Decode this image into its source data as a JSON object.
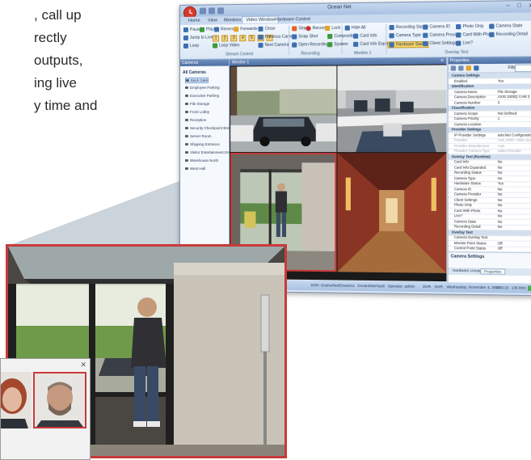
{
  "side_text": {
    "lines": [
      ", call up",
      "rectly",
      "outputs,",
      "ing live",
      "y time and"
    ]
  },
  "app": {
    "title": "Ocean Net",
    "window_buttons": [
      "–",
      "□",
      "✕"
    ],
    "ribbon_tabs": [
      "Home",
      "View",
      "Monitors",
      "Video Window",
      "Hardware Control"
    ],
    "active_tab": "Video Window",
    "ribbon": {
      "stream_control": {
        "label": "Stream Control",
        "buttons": [
          "Pause",
          "Play",
          "Reverse",
          "Forwards",
          "Close",
          "Jump to Live",
          "Loop",
          "Loop Video",
          "Previous Camera",
          "Next Camera"
        ],
        "numbers": [
          "1",
          "2",
          "3",
          "4",
          "5",
          "6",
          "7"
        ]
      },
      "recording": {
        "label": "Recording",
        "buttons": [
          "Snap Shot",
          "Open Recording",
          "Stop",
          "Record",
          "Lock"
        ]
      },
      "monitor1": {
        "label": "Monitor 1",
        "buttons": [
          "Composite",
          "System",
          "Hide All",
          "Card Info",
          "Card Info Expanded"
        ]
      },
      "overlay_text": {
        "label": "Overlay Text",
        "buttons": [
          "Recording Status",
          "Camera Type",
          "Hardware Status",
          "Camera ID",
          "Camera Provider",
          "Client Settings",
          "Photo Only",
          "Card With Photo",
          "Live?",
          "Camera State",
          "Recording Detail"
        ]
      }
    },
    "cameras_panel": {
      "title": "Cameras",
      "all_label": "All Cameras",
      "items": [
        "Back Gate",
        "Employee Parking",
        "Executive Parking",
        "File Storage",
        "Front Lobby",
        "Reception",
        "Security Checkpoint Breva",
        "Server Room",
        "Shipping Entrance",
        "Visitor Entertainment Entran..",
        "Warehouse North",
        "West Hall"
      ]
    },
    "monitor": {
      "title": "Monitor 1",
      "close": "✕"
    },
    "properties": {
      "title": "Properties",
      "filter_label": "Filter:",
      "rows": [
        {
          "key": "Camera Settings",
          "value": "",
          "section": true
        },
        {
          "key": "Enabled",
          "value": "Yes"
        },
        {
          "key": "Identification",
          "value": "",
          "section": true
        },
        {
          "key": "Camera Name",
          "value": "File Storage"
        },
        {
          "key": "Camera Description",
          "value": "AXIS 2400Q CAM 3"
        },
        {
          "key": "Camera Number",
          "value": "3"
        },
        {
          "key": "Classification",
          "value": "",
          "section": true
        },
        {
          "key": "Camera Scope",
          "value": "Not Defined"
        },
        {
          "key": "Camera Priority",
          "value": "1"
        },
        {
          "key": "Camera Location",
          "value": ""
        },
        {
          "key": "Provider Settings",
          "value": "",
          "section": true
        },
        {
          "key": "IP Provider Settings",
          "value": "axis:Net Configuration"
        },
        {
          "key": "Provider",
          "value": "Axis 2400+ video server",
          "dim": true
        },
        {
          "key": "Provider Manufacturer",
          "value": "Axis",
          "dim": true
        },
        {
          "key": "Provider Camera Type",
          "value": "Video Encoder",
          "dim": true
        },
        {
          "key": "Overlay Text (Runtime)",
          "value": "",
          "section": true
        },
        {
          "key": "Card Info",
          "value": "No"
        },
        {
          "key": "Card Info Expanded",
          "value": "No"
        },
        {
          "key": "Recording Status",
          "value": "No"
        },
        {
          "key": "Camera Type",
          "value": "No"
        },
        {
          "key": "Hardware Status",
          "value": "Yes"
        },
        {
          "key": "Camera ID",
          "value": "No"
        },
        {
          "key": "Camera Provider",
          "value": "No"
        },
        {
          "key": "Client Settings",
          "value": "No"
        },
        {
          "key": "Photo Only",
          "value": "No"
        },
        {
          "key": "Card With Photo",
          "value": "No"
        },
        {
          "key": "Live?",
          "value": "No"
        },
        {
          "key": "Camera State",
          "value": "No"
        },
        {
          "key": "Recording Detail",
          "value": "No"
        },
        {
          "key": "Overlay Text",
          "value": "",
          "section": true
        },
        {
          "key": "Camera Overlay Text",
          "value": ""
        },
        {
          "key": "Monitor Point Status",
          "value": "Off"
        },
        {
          "key": "Control Point Status",
          "value": "Off"
        }
      ],
      "footer_title": "Camera Settings",
      "tabs": [
        "Hardware Lineage",
        "Properties"
      ],
      "active_tab": "Properties"
    },
    "status": {
      "items": [
        "DSN: Grains/Net/Dreams1",
        "Ocean/Net/Vault",
        "Operator: admin",
        "DVR",
        "NVR",
        "Wednesday, November 4, 2009",
        "2:16:23",
        "136 kb/s",
        "100 kb/s"
      ]
    }
  },
  "faces_panel": {
    "close": "✕"
  },
  "colors": {
    "accent_red": "#c93a3a",
    "ribbon_blue": "#c9daef",
    "panel_header": "#4d6fa3"
  }
}
